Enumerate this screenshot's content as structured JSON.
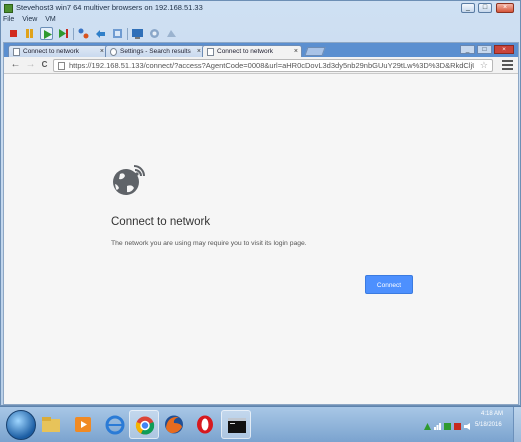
{
  "vm": {
    "title": "Stevehost3 win7 64 multiver browsers on 192.168.51.33",
    "menu": [
      "File",
      "View",
      "VM"
    ],
    "window_buttons": [
      "_",
      "□",
      "×"
    ]
  },
  "browser": {
    "tabs": [
      {
        "label": "Connect to network",
        "close": "×"
      },
      {
        "label": "Settings - Search results",
        "close": "×"
      },
      {
        "label": "Connect to network",
        "close": "×"
      }
    ],
    "window_buttons": [
      "_",
      "□",
      "×"
    ],
    "nav": {
      "back": "←",
      "forward": "→",
      "reload": "C"
    },
    "url": "https://192.168.51.133/connect/?access?AgentCode=0008&url=aHR0cDovL3d3dy5nb29nbGUuY29tLw%3D%3D&RkdCljUnNvb9nZW5lcmF0ZV8yM",
    "star": "☆"
  },
  "page": {
    "title": "Connect to network",
    "description": "The network you are using may require you to visit its login page.",
    "connect_button": "Connect"
  },
  "taskbar": {
    "time": "4:18 AM",
    "date": "5/18/2016"
  },
  "colors": {
    "accent": "#4d90fe",
    "tabstrip": "#5b8fd0",
    "page_bg": "#f6f6f6"
  }
}
